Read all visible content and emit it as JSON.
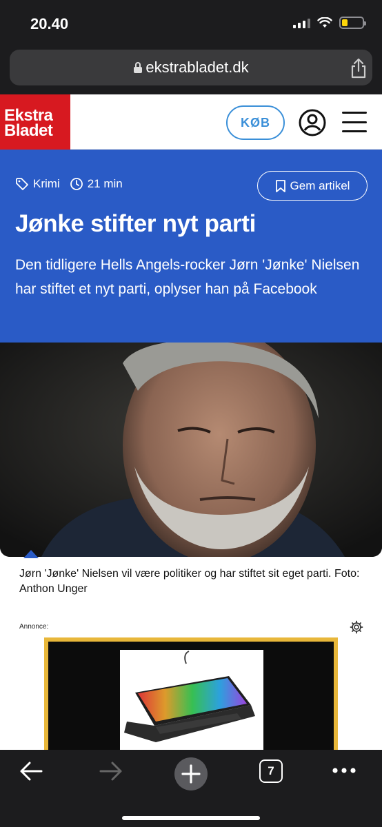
{
  "status_bar": {
    "time": "20.40"
  },
  "browser": {
    "url": "ekstrabladet.dk",
    "open_tabs": "7"
  },
  "site": {
    "logo_line1": "Ekstra",
    "logo_line2": "Bladet",
    "buy_label": "KØB"
  },
  "article": {
    "category": "Krimi",
    "age": "21 min",
    "save_label": "Gem artikel",
    "headline": "Jønke stifter nyt parti",
    "lead": "Den tidligere Hells Angels-rocker Jørn 'Jønke' Nielsen har stiftet et nyt parti, oplyser han på Facebook",
    "caption": "Jørn 'Jønke' Nielsen vil være politiker og har stiftet sit eget parti. Foto: Anthon Unger"
  },
  "ad": {
    "label": "Annonce:"
  },
  "colors": {
    "brand_red": "#d71920",
    "hero_blue": "#2a5bc6",
    "buy_blue": "#3a8fd8",
    "ad_border": "#e8b73a"
  }
}
